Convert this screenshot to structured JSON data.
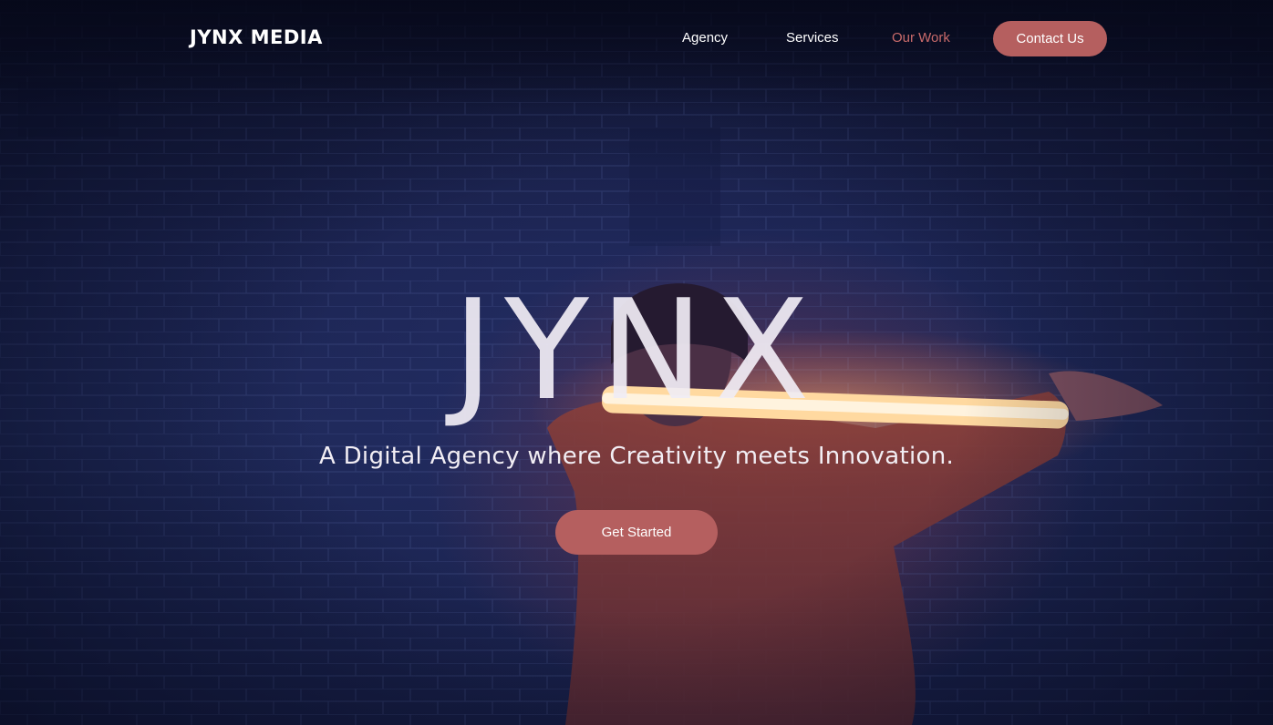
{
  "nav": {
    "logo": "JYNX MEDIA",
    "links": [
      {
        "label": "Agency",
        "active": false
      },
      {
        "label": "Services",
        "active": false
      },
      {
        "label": "Our Work",
        "active": true
      }
    ],
    "contact_label": "Contact Us"
  },
  "hero": {
    "title": "JYNX",
    "subtitle": "A Digital Agency where Creativity meets Innovation.",
    "cta_label": "Get Started",
    "background_image": "person-holding-glowing-light-tube-photo"
  },
  "colors": {
    "accent": "#b55f5f",
    "active_link": "#c96a6a",
    "background": "#1b2350",
    "text": "#ffffff"
  }
}
